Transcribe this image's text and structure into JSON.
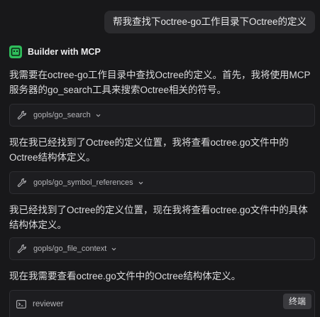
{
  "user_message": "帮我查找下octree-go工作目录下Octree的定义",
  "agent": {
    "name": "Builder with MCP",
    "icon": "terminal-icon",
    "accent": "#2fbd5b"
  },
  "paragraphs": [
    "我需要在octree-go工作目录中查找Octree的定义。首先，我将使用MCP服务器的go_search工具来搜索Octree相关的符号。",
    "现在我已经找到了Octree的定义位置，我将查看octree.go文件中的Octree结构体定义。",
    "我已经找到了Octree的定义位置，现在我将查看octree.go文件中的具体结构体定义。",
    "现在我需要查看octree.go文件中的Octree结构体定义。"
  ],
  "tool_calls": [
    {
      "label": "gopls/go_search",
      "icon": "wrench-icon"
    },
    {
      "label": "gopls/go_symbol_references",
      "icon": "wrench-icon"
    },
    {
      "label": "gopls/go_file_context",
      "icon": "wrench-icon"
    }
  ],
  "reviewer": {
    "label": "reviewer",
    "icon": "terminal-icon",
    "stop_label": "终端"
  }
}
